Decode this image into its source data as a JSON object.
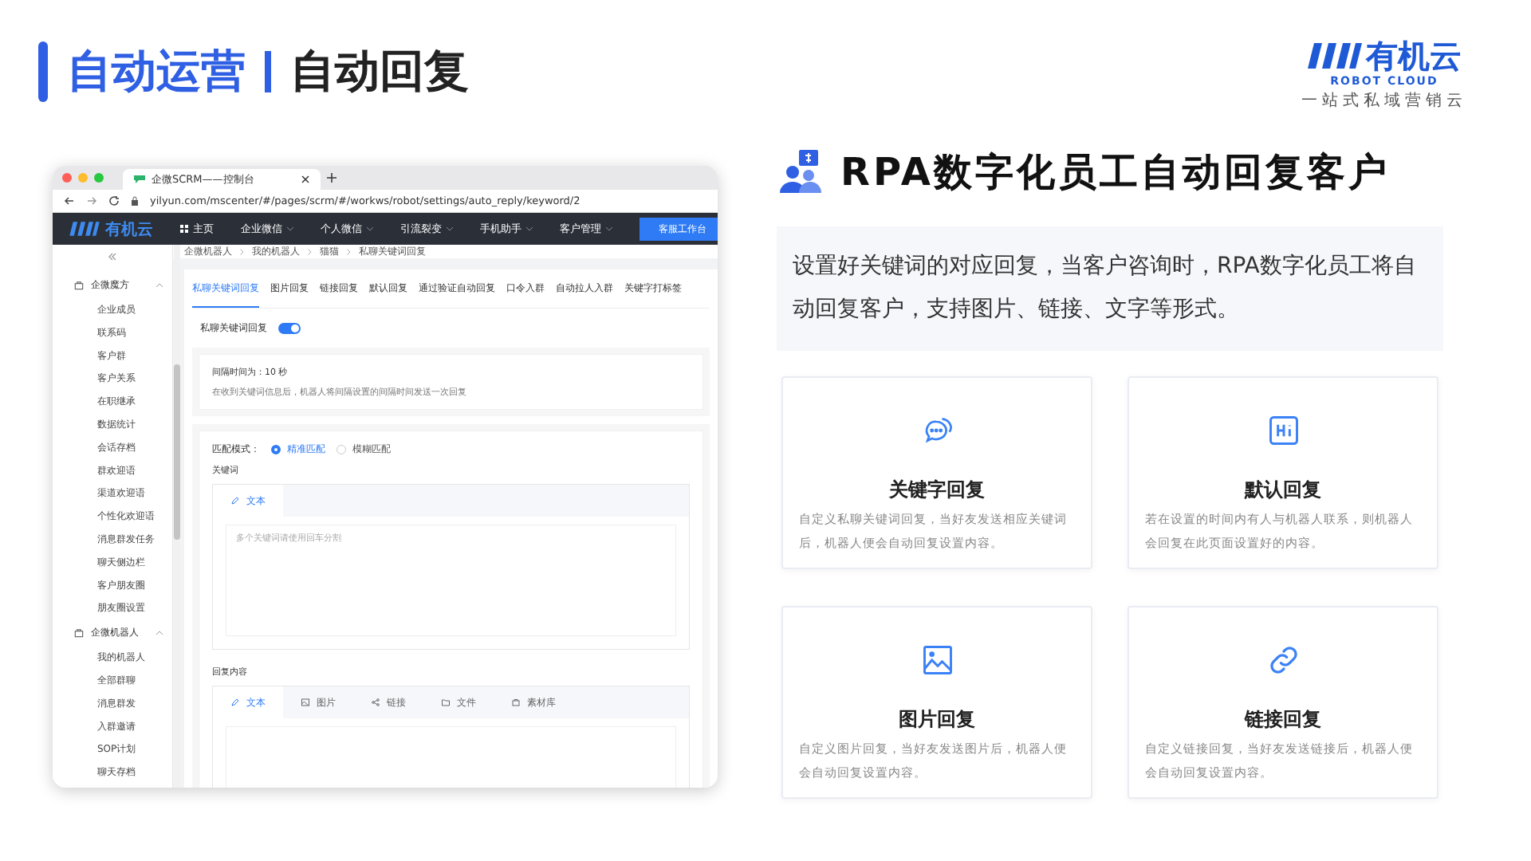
{
  "header": {
    "section": "自动运营",
    "title": "自动回复"
  },
  "logo": {
    "name": "有机云",
    "subtitle": "ROBOT CLOUD",
    "slogan": "一站式私域营销云"
  },
  "screenshot": {
    "browser_tab": "企微SCRM——控制台",
    "url": "yilyun.com/mscenter/#/pages/scrm/#/workws/robot/settings/auto_reply/keyword/2",
    "nav_logo": "有机云",
    "nav": [
      {
        "label": "主页",
        "has_menu": false
      },
      {
        "label": "企业微信",
        "has_menu": true
      },
      {
        "label": "个人微信",
        "has_menu": true
      },
      {
        "label": "引流裂变",
        "has_menu": true
      },
      {
        "label": "手机助手",
        "has_menu": true
      },
      {
        "label": "客户管理",
        "has_menu": true
      }
    ],
    "nav_button": "客服工作台",
    "breadcrumb": [
      "企微机器人",
      "我的机器人",
      "猫猫",
      "私聊关键词回复"
    ],
    "sidebar": [
      {
        "label": "企微魔方",
        "expanded": true,
        "children": [
          {
            "label": "企业成员"
          },
          {
            "label": "联系码"
          },
          {
            "label": "客户群"
          },
          {
            "label": "客户关系"
          },
          {
            "label": "在职继承"
          },
          {
            "label": "数据统计"
          },
          {
            "label": "会话存档"
          },
          {
            "label": "群欢迎语"
          },
          {
            "label": "渠道欢迎语"
          },
          {
            "label": "个性化欢迎语"
          },
          {
            "label": "消息群发任务"
          },
          {
            "label": "聊天侧边栏"
          },
          {
            "label": "客户朋友圈"
          },
          {
            "label": "朋友圈设置"
          }
        ]
      },
      {
        "label": "企微机器人",
        "expanded": true,
        "children": [
          {
            "label": "我的机器人"
          },
          {
            "label": "全部群聊"
          },
          {
            "label": "消息群发"
          },
          {
            "label": "入群邀请"
          },
          {
            "label": "SOP计划"
          },
          {
            "label": "聊天存档"
          }
        ]
      }
    ],
    "tabs": [
      {
        "label": "私聊关键词回复",
        "selected": true
      },
      {
        "label": "图片回复",
        "selected": false
      },
      {
        "label": "链接回复",
        "selected": false
      },
      {
        "label": "默认回复",
        "selected": false
      },
      {
        "label": "通过验证自动回复",
        "selected": false
      },
      {
        "label": "口令入群",
        "selected": false
      },
      {
        "label": "自动拉人入群",
        "selected": false
      },
      {
        "label": "关键字打标签",
        "selected": false
      }
    ],
    "toggle": {
      "label": "私聊关键词回复",
      "on": true
    },
    "interval": "间隔时间为：10 秒",
    "interval_note": "在收到关键词信息后，机器人将间隔设置的间隔时间发送一次回复",
    "match": {
      "label": "匹配模式：",
      "options": [
        {
          "label": "精准匹配",
          "selected": true
        },
        {
          "label": "模糊匹配",
          "selected": false
        }
      ]
    },
    "keyword": {
      "label": "关键词",
      "tab": "文本",
      "placeholder": "多个关键词请使用回车分割"
    },
    "reply": {
      "label": "回复内容",
      "tabs": [
        {
          "label": "文本",
          "kind": "text",
          "selected": true
        },
        {
          "label": "图片",
          "kind": "image",
          "selected": false
        },
        {
          "label": "链接",
          "kind": "link",
          "selected": false
        },
        {
          "label": "文件",
          "kind": "file",
          "selected": false
        },
        {
          "label": "素材库",
          "kind": "library",
          "selected": false
        }
      ]
    }
  },
  "feature": {
    "title": "RPA数字化员工自动回复客户",
    "description": "设置好关键词的对应回复，当客户咨询时，RPA数字化员工将自动回复客户，支持图片、链接、文字等形式。"
  },
  "cards": [
    {
      "kind": "chat",
      "title": "关键字回复",
      "text": "自定义私聊关键词回复，当好友发送相应关键词后，机器人便会自动回复设置内容。"
    },
    {
      "kind": "hi",
      "title": "默认回复",
      "text": "若在设置的时间内有人与机器人联系，则机器人会回复在此页面设置好的内容。"
    },
    {
      "kind": "image",
      "title": "图片回复",
      "text": "自定义图片回复，当好友发送图片后，机器人便会自动回复设置内容。"
    },
    {
      "kind": "link",
      "title": "链接回复",
      "text": "自定义链接回复，当好友发送链接后，机器人便会自动回复设置内容。"
    }
  ]
}
